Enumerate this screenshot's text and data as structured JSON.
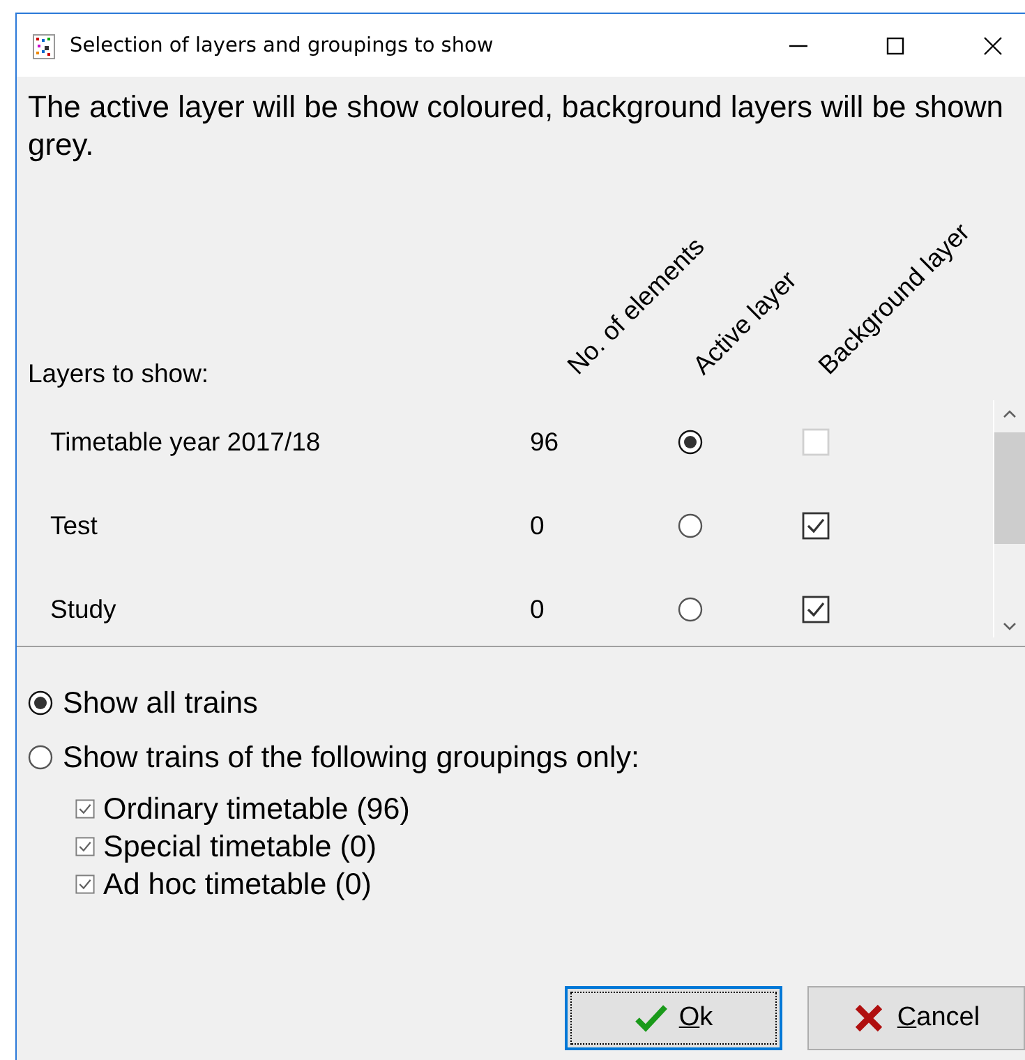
{
  "window": {
    "title": "Selection of layers and groupings to show"
  },
  "intro": "The active layer will be show coloured, background layers will be shown grey.",
  "layers": {
    "label": "Layers to show:",
    "columns": [
      "No. of elements",
      "Active layer",
      "Background layer"
    ],
    "rows": [
      {
        "name": "Timetable year 2017/18",
        "count": "96",
        "active": true,
        "background": false,
        "background_disabled": true
      },
      {
        "name": "Test",
        "count": "0",
        "active": false,
        "background": true,
        "background_disabled": false
      },
      {
        "name": "Study",
        "count": "0",
        "active": false,
        "background": true,
        "background_disabled": false
      }
    ]
  },
  "filter": {
    "options": [
      {
        "label": "Show all trains",
        "selected": true
      },
      {
        "label": "Show trains of the following groupings only:",
        "selected": false
      }
    ],
    "groupings": [
      {
        "label": "Ordinary timetable (96)",
        "checked": true
      },
      {
        "label": "Special timetable (0)",
        "checked": true
      },
      {
        "label": "Ad hoc timetable (0)",
        "checked": true
      }
    ]
  },
  "buttons": [
    {
      "label": "Ok",
      "kind": "ok",
      "focused": true
    },
    {
      "label": "Cancel",
      "kind": "cancel",
      "focused": false
    }
  ]
}
